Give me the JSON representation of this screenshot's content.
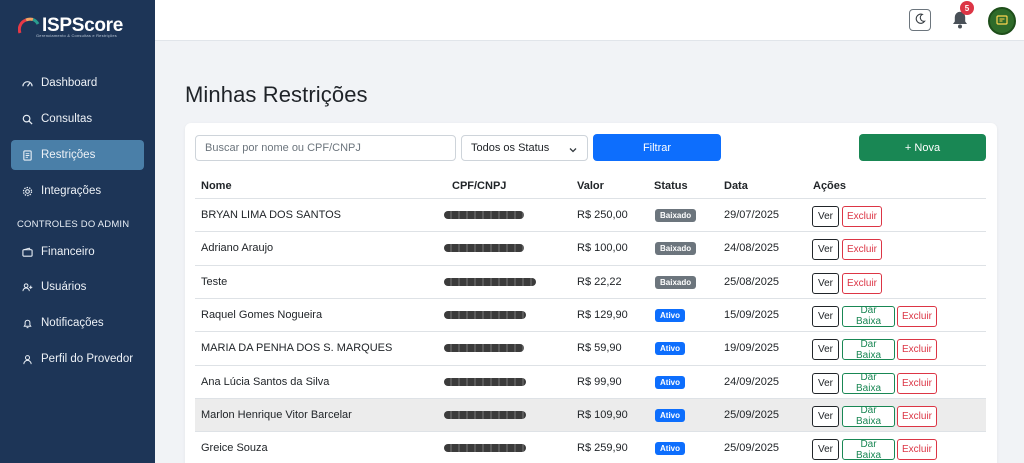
{
  "brand": {
    "name": "ISPScore",
    "tagline": "Gerenciamento & Consultas e Restrições"
  },
  "sidebar": {
    "items": [
      {
        "label": "Dashboard",
        "icon": "dashboard-icon"
      },
      {
        "label": "Consultas",
        "icon": "search-icon"
      },
      {
        "label": "Restrições",
        "icon": "document-icon",
        "active": true
      },
      {
        "label": "Integrações",
        "icon": "gear-icon"
      }
    ],
    "admin_title": "CONTROLES DO ADMIN",
    "admin_items": [
      {
        "label": "Financeiro",
        "icon": "wallet-icon"
      },
      {
        "label": "Usuários",
        "icon": "users-icon"
      },
      {
        "label": "Notificações",
        "icon": "bell-icon"
      },
      {
        "label": "Perfil do Provedor",
        "icon": "user-icon"
      }
    ]
  },
  "header": {
    "notification_count": "5"
  },
  "main": {
    "title": "Minhas Restrições",
    "search_placeholder": "Buscar por nome ou CPF/CNPJ",
    "status_select": "Todos os Status",
    "filter_label": "Filtrar",
    "new_label": "+ Nova",
    "columns": [
      "Nome",
      "CPF/CNPJ",
      "Valor",
      "Status",
      "Data",
      "Ações"
    ],
    "actions": {
      "ver": "Ver",
      "dar_baixa": "Dar Baixa",
      "excluir": "Excluir"
    },
    "rows": [
      {
        "nome": "BRYAN LIMA DOS SANTOS",
        "valor": "R$ 250,00",
        "status": "Baixado",
        "data": "29/07/2025"
      },
      {
        "nome": "Adriano Araujo",
        "valor": "R$ 100,00",
        "status": "Baixado",
        "data": "24/08/2025"
      },
      {
        "nome": "Teste",
        "valor": "R$ 22,22",
        "status": "Baixado",
        "data": "25/08/2025"
      },
      {
        "nome": "Raquel Gomes Nogueira",
        "valor": "R$ 129,90",
        "status": "Ativo",
        "data": "15/09/2025"
      },
      {
        "nome": "MARIA DA PENHA DOS S. MARQUES",
        "valor": "R$ 59,90",
        "status": "Ativo",
        "data": "19/09/2025"
      },
      {
        "nome": "Ana Lúcia Santos da Silva",
        "valor": "R$ 99,90",
        "status": "Ativo",
        "data": "24/09/2025"
      },
      {
        "nome": "Marlon Henrique Vitor Barcelar",
        "valor": "R$ 109,90",
        "status": "Ativo",
        "data": "25/09/2025"
      },
      {
        "nome": "Greice Souza",
        "valor": "R$ 259,90",
        "status": "Ativo",
        "data": "25/09/2025"
      }
    ]
  }
}
